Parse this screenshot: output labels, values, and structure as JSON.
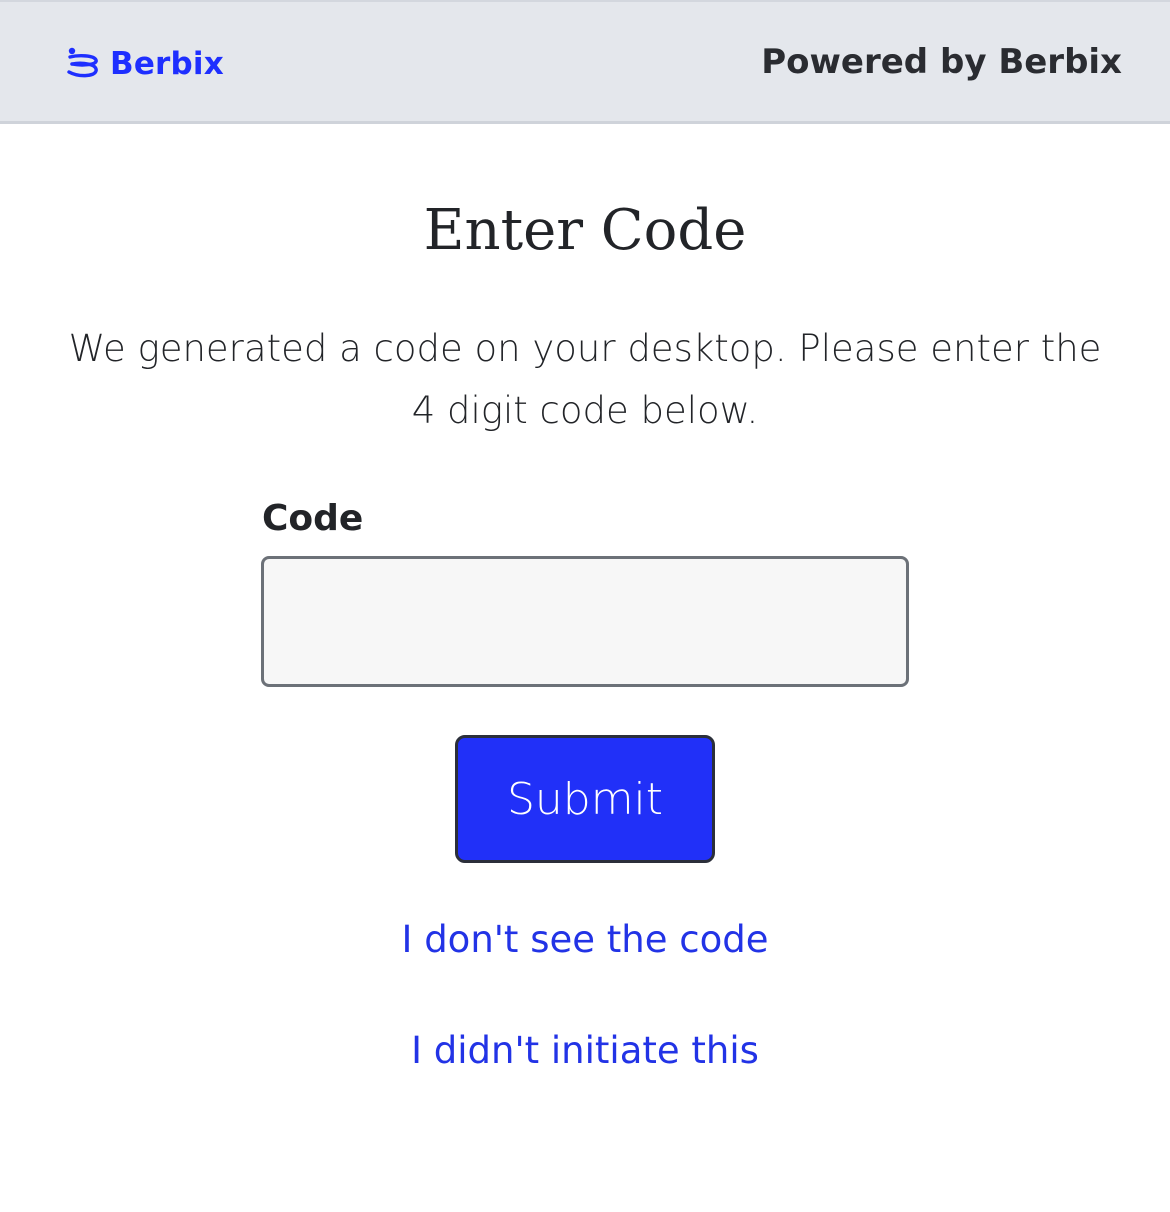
{
  "header": {
    "logo_icon": "berbix-logo-icon",
    "logo_text": "Berbix",
    "powered_by": "Powered by Berbix"
  },
  "main": {
    "title": "Enter Code",
    "description": "We generated a code on your desktop. Please enter the 4 digit code below.",
    "code_label": "Code",
    "code_value": "",
    "code_placeholder": "",
    "submit_label": "Submit",
    "link_no_code": "I don't see the code",
    "link_not_initiated": "I didn't initiate this"
  },
  "colors": {
    "brand": "#1e2fff",
    "button": "#2130f8",
    "link": "#2233e6",
    "header_bg": "#e4e7ec",
    "input_bg": "#f7f7f7"
  }
}
